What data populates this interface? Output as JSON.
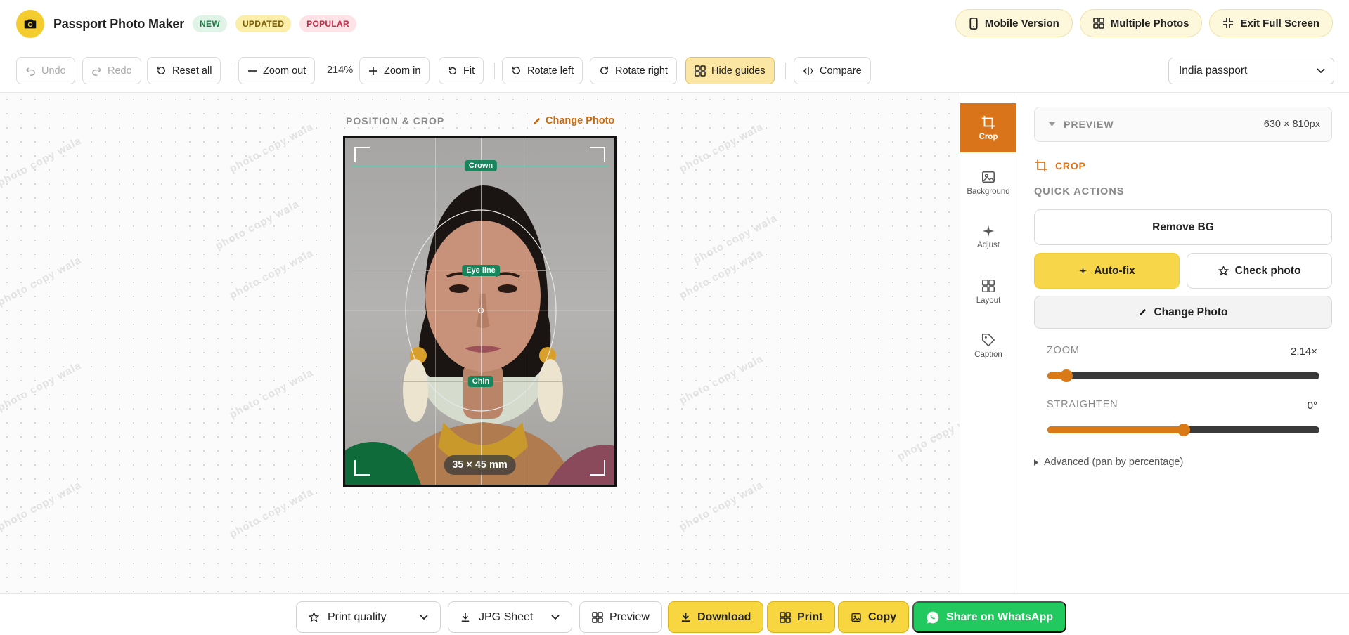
{
  "header": {
    "app_title": "Passport Photo Maker",
    "badges": [
      "NEW",
      "UPDATED",
      "POPULAR"
    ],
    "buttons": {
      "mobile": "Mobile Version",
      "multiple": "Multiple Photos",
      "exit_fullscreen": "Exit Full Screen"
    }
  },
  "toolbar": {
    "undo": "Undo",
    "redo": "Redo",
    "reset": "Reset all",
    "zoom_out": "Zoom out",
    "zoom_value": "214%",
    "zoom_in": "Zoom in",
    "fit": "Fit",
    "rotate_left": "Rotate left",
    "rotate_right": "Rotate right",
    "hide_guides": "Hide guides",
    "compare": "Compare",
    "document_select": "India passport"
  },
  "canvas": {
    "section_label": "POSITION & CROP",
    "change_photo": "Change Photo",
    "guides": {
      "crown": "Crown",
      "eyeline": "Eye line",
      "chin": "Chin"
    },
    "size_label": "35 × 45 mm",
    "watermark": "photo copy wala"
  },
  "rail": {
    "items": [
      {
        "label": "Crop"
      },
      {
        "label": "Background"
      },
      {
        "label": "Adjust"
      },
      {
        "label": "Layout"
      },
      {
        "label": "Caption"
      }
    ]
  },
  "panel": {
    "preview_title": "PREVIEW",
    "preview_dims": "630 × 810px",
    "crop_heading": "CROP",
    "quick_actions_heading": "QUICK ACTIONS",
    "remove_bg": "Remove BG",
    "auto_fix": "Auto-fix",
    "check_photo": "Check photo",
    "change_photo": "Change Photo",
    "zoom": {
      "label": "ZOOM",
      "value_text": "2.14×",
      "fraction": 0.07
    },
    "straighten": {
      "label": "STRAIGHTEN",
      "value_text": "0°",
      "fraction": 0.5
    },
    "advanced": "Advanced (pan by percentage)"
  },
  "footer": {
    "print_quality": "Print quality",
    "jpg_sheet": "JPG Sheet",
    "preview": "Preview",
    "download": "Download",
    "print": "Print",
    "copy": "Copy",
    "share_whatsapp": "Share on WhatsApp"
  },
  "colors": {
    "accent_orange": "#d9741b",
    "brand_yellow": "#f4cc2d",
    "whatsapp_green": "#22c95e",
    "guide_green": "#19855d"
  }
}
